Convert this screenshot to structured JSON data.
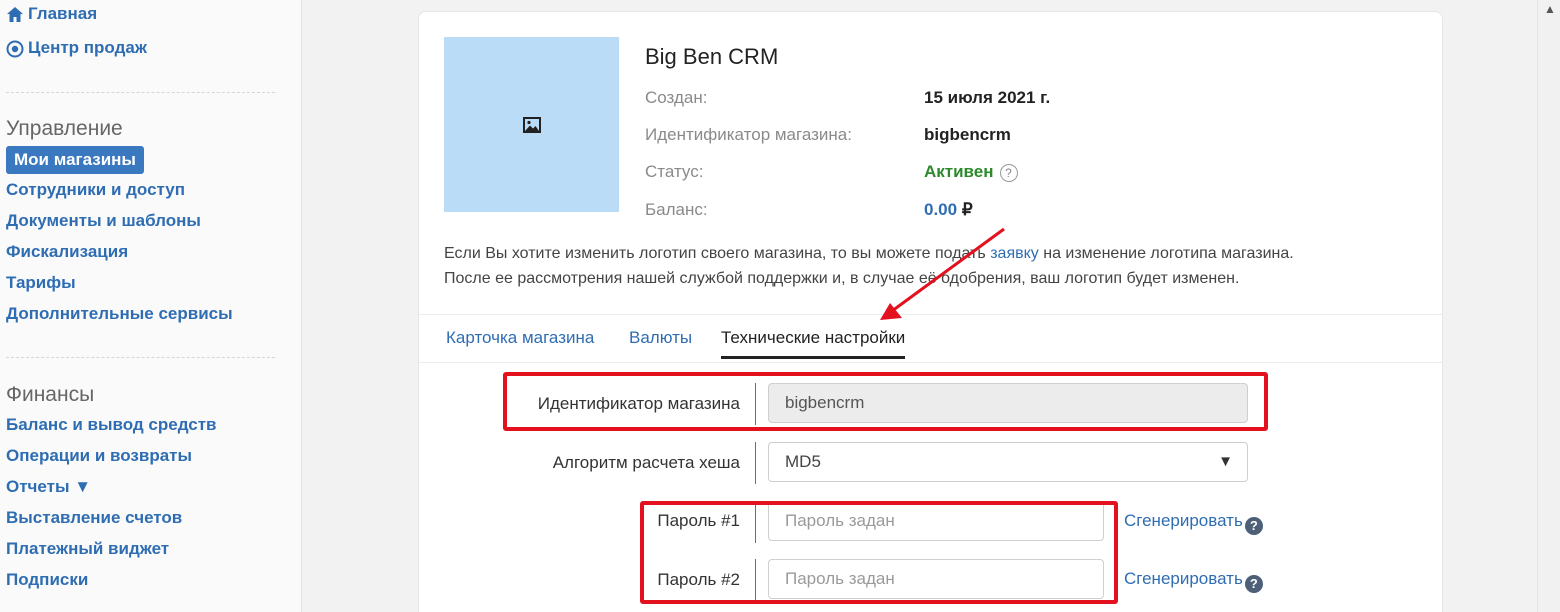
{
  "sidebar": {
    "home": "Главная",
    "sales_center": "Центр продаж",
    "management_title": "Управление",
    "management_items": [
      "Мои магазины",
      "Сотрудники и доступ",
      "Документы и шаблоны",
      "Фискализация",
      "Тарифы",
      "Дополнительные сервисы"
    ],
    "finance_title": "Финансы",
    "finance_items": [
      "Баланс и вывод средств",
      "Операции и возвраты",
      "Отчеты ▼",
      "Выставление счетов",
      "Платежный виджет",
      "Подписки"
    ]
  },
  "shop": {
    "title": "Big Ben CRM",
    "created_label": "Создан:",
    "created_value": "15 июля 2021 г.",
    "id_label": "Идентификатор магазина:",
    "id_value": "bigbencrm",
    "status_label": "Статус:",
    "status_value": "Активен",
    "balance_label": "Баланс:",
    "balance_value": "0.00",
    "currency": "₽"
  },
  "notice": {
    "part1": "Если Вы хотите изменить логотип своего магазина, то вы можете подать ",
    "link": "заявку",
    "part2": " на изменение логотипа магазина.",
    "line2": "После ее рассмотрения нашей службой поддержки и, в случае её одобрения, ваш логотип будет изменен."
  },
  "tabs": [
    "Карточка магазина",
    "Валюты",
    "Технические настройки"
  ],
  "form": {
    "shop_id_label": "Идентификатор магазина",
    "shop_id_value": "bigbencrm",
    "hash_label": "Алгоритм расчета хеша",
    "hash_value": "MD5",
    "password1_label": "Пароль #1",
    "password1_placeholder": "Пароль задан",
    "password2_label": "Пароль #2",
    "password2_placeholder": "Пароль задан",
    "generate_label": "Сгенерировать",
    "help_mark": "?"
  },
  "colors": {
    "accent": "#2f6db3",
    "active_nav": "#3a78bf",
    "status_active": "#2d8a2d",
    "highlight": "#e3101d"
  }
}
